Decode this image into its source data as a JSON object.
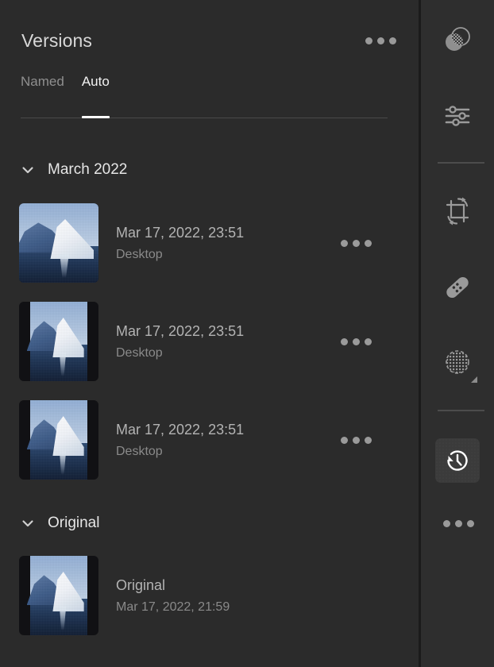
{
  "panel": {
    "title": "Versions",
    "overflow_icon": "ellipsis-icon",
    "tabs": [
      {
        "label": "Named",
        "active": false
      },
      {
        "label": "Auto",
        "active": true
      }
    ],
    "sections": [
      {
        "label": "March 2022",
        "expanded": true,
        "chevron_icon": "chevron-down-icon",
        "items": [
          {
            "title": "Mar 17, 2022, 23:51",
            "subtitle": "Desktop",
            "thumbnail": "iceberg-thumbnail",
            "has_overflow": true
          },
          {
            "title": "Mar 17, 2022, 23:51",
            "subtitle": "Desktop",
            "thumbnail": "iceberg-thumbnail",
            "has_overflow": true
          },
          {
            "title": "Mar 17, 2022, 23:51",
            "subtitle": "Desktop",
            "thumbnail": "iceberg-thumbnail",
            "has_overflow": true
          }
        ]
      },
      {
        "label": "Original",
        "expanded": true,
        "chevron_icon": "chevron-down-icon",
        "items": [
          {
            "title": "Original",
            "subtitle": "Mar 17, 2022, 21:59",
            "thumbnail": "iceberg-thumbnail",
            "has_overflow": false
          }
        ]
      }
    ]
  },
  "toolbar": {
    "tools": [
      {
        "name": "masking-icon",
        "selected": false
      },
      {
        "name": "edit-sliders-icon",
        "selected": false
      },
      {
        "name": "crop-rotate-icon",
        "selected": false
      },
      {
        "name": "healing-brush-icon",
        "selected": false
      },
      {
        "name": "red-eye-icon",
        "selected": false
      },
      {
        "name": "versions-history-icon",
        "selected": true
      }
    ],
    "more_icon": "ellipsis-icon"
  },
  "colors": {
    "panel_background": "#2b2b2b",
    "toolbar_background": "#2e2e2e",
    "divider": "#1b1b1b",
    "accent_indicator": "#ffffff",
    "primary_text": "#e6e6e6",
    "secondary_text": "#b3b3b3",
    "muted_text": "#8a8a8a",
    "selected_tool_background": "#3b3b3b"
  }
}
